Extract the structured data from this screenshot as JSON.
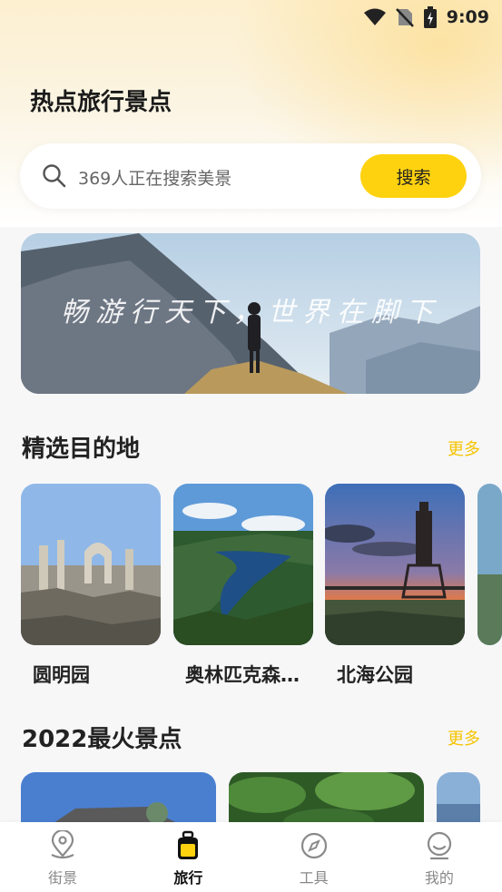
{
  "status_bar": {
    "time": "9:09"
  },
  "header": {
    "title": "热点旅行景点"
  },
  "search": {
    "placeholder": "369人正在搜索美景",
    "button_label": "搜索"
  },
  "banner": {
    "slogan": "畅游行天下，世界在脚下"
  },
  "featured": {
    "title": "精选目的地",
    "more_label": "更多",
    "items": [
      {
        "name": "圆明园"
      },
      {
        "name": "奥林匹克森林公园"
      },
      {
        "name": "北海公园"
      }
    ]
  },
  "hot": {
    "title": "2022最火景点",
    "more_label": "更多"
  },
  "bottom_nav": {
    "items": [
      {
        "label": "街景",
        "icon": "location-pin-icon"
      },
      {
        "label": "旅行",
        "icon": "suitcase-icon"
      },
      {
        "label": "工具",
        "icon": "compass-icon"
      },
      {
        "label": "我的",
        "icon": "profile-icon"
      }
    ],
    "active_index": 1
  },
  "colors": {
    "accent": "#ffd20f",
    "more_link": "#f5c400"
  }
}
